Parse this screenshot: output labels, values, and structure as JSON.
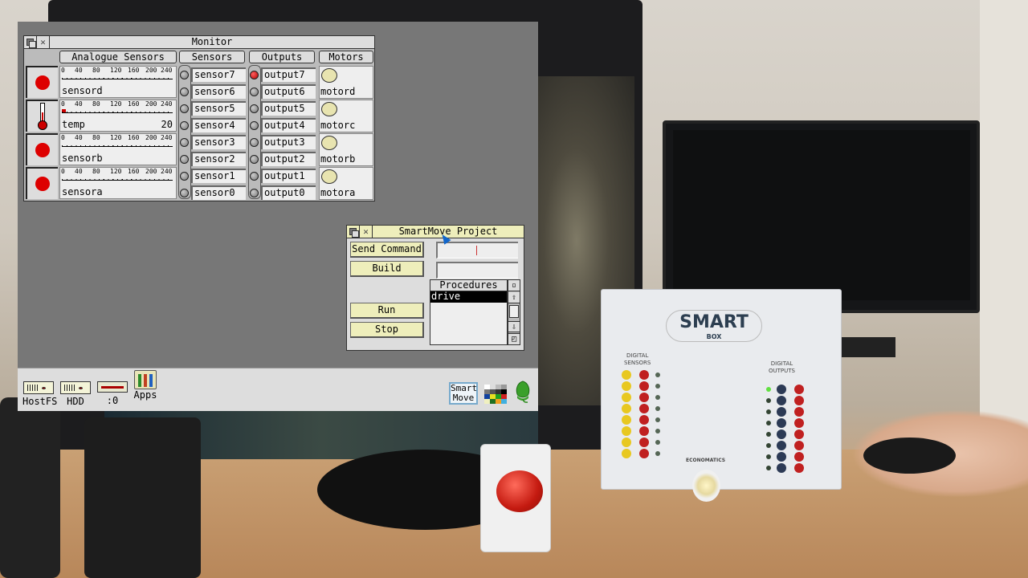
{
  "monitor_window": {
    "title": "Monitor",
    "headers": {
      "analogue": "Analogue Sensors",
      "sensors": "Sensors",
      "outputs": "Outputs",
      "motors": "Motors"
    },
    "scale_ticks": [
      "0",
      "40",
      "80",
      "120",
      "160",
      "200",
      "240"
    ],
    "analogue_sensors": [
      {
        "name": "sensord",
        "icon": "red-dot-icon",
        "value": "",
        "level": 0
      },
      {
        "name": "temp",
        "icon": "thermometer-icon",
        "value": "20",
        "level": 20
      },
      {
        "name": "sensorb",
        "icon": "red-dot-icon",
        "value": "",
        "level": 0
      },
      {
        "name": "sensora",
        "icon": "red-dot-icon",
        "value": "",
        "level": 0
      }
    ],
    "digital_sensors": [
      {
        "name": "sensor7",
        "on": false
      },
      {
        "name": "sensor6",
        "on": false
      },
      {
        "name": "sensor5",
        "on": false
      },
      {
        "name": "sensor4",
        "on": false
      },
      {
        "name": "sensor3",
        "on": false
      },
      {
        "name": "sensor2",
        "on": false
      },
      {
        "name": "sensor1",
        "on": false
      },
      {
        "name": "sensor0",
        "on": false
      }
    ],
    "outputs": [
      {
        "name": "output7",
        "on": true
      },
      {
        "name": "output6",
        "on": false
      },
      {
        "name": "output5",
        "on": false
      },
      {
        "name": "output4",
        "on": false
      },
      {
        "name": "output3",
        "on": false
      },
      {
        "name": "output2",
        "on": false
      },
      {
        "name": "output1",
        "on": false
      },
      {
        "name": "output0",
        "on": false
      }
    ],
    "motors": [
      {
        "name": "motord"
      },
      {
        "name": "motorc"
      },
      {
        "name": "motorb"
      },
      {
        "name": "motora"
      }
    ]
  },
  "project_window": {
    "title": "SmartMove Project",
    "send_command_label": "Send Command",
    "build_label": "Build",
    "command_value": "",
    "build_value": "",
    "run_label": "Run",
    "stop_label": "Stop",
    "procedures_title": "Procedures",
    "procedures": [
      "drive"
    ],
    "selected_procedure": "drive"
  },
  "iconbar": {
    "items": [
      {
        "label": "HostFS",
        "icon": "hard-drive-icon"
      },
      {
        "label": "HDD",
        "icon": "hard-drive-icon"
      },
      {
        "label": ":0",
        "icon": "floppy-drive-icon"
      },
      {
        "label": "Apps",
        "icon": "apps-folder-icon"
      }
    ],
    "smartmove_label_line1": "Smart",
    "smartmove_label_line2": "Move"
  },
  "smartbox_device": {
    "logo": "SMART",
    "logo_sub": "BOX",
    "left_panel_label_1": "DIGITAL",
    "left_panel_label_2": "SENSORS",
    "right_panel_label_1": "DIGITAL",
    "right_panel_label_2": "OUTPUTS",
    "brand": "ECONOMATICS"
  },
  "colors": {
    "desktop_bg": "#777777",
    "window_bg": "#dddddd",
    "focus_title": "#eeeebb",
    "led_on": "#cc0000",
    "button_bg": "#eeeebb"
  }
}
